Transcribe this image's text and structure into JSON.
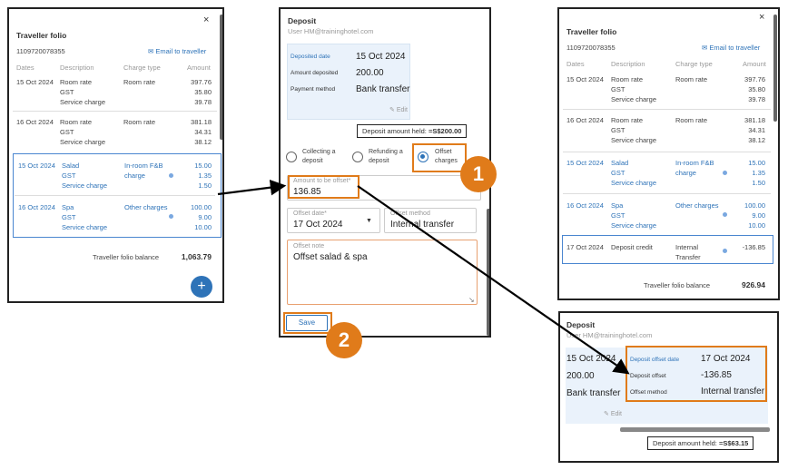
{
  "left_folio": {
    "title": "Traveller folio",
    "folio_number": "1109720078355",
    "email_label": "Email to traveller",
    "headers": [
      "Dates",
      "Description",
      "Charge type",
      "Amount"
    ],
    "rows": [
      {
        "date": "15 Oct 2024",
        "desc": [
          "Room rate",
          "GST",
          "Service charge"
        ],
        "type": "Room rate",
        "amounts": [
          "397.76",
          "35.80",
          "39.78"
        ]
      },
      {
        "date": "16 Oct 2024",
        "desc": [
          "Room rate",
          "GST",
          "Service charge"
        ],
        "type": "Room rate",
        "amounts": [
          "381.18",
          "34.31",
          "38.12"
        ]
      },
      {
        "date": "15 Oct 2024",
        "desc": [
          "Salad",
          "GST",
          "Service charge"
        ],
        "type": [
          "In-room F&B",
          "charge"
        ],
        "amounts": [
          "15.00",
          "1.35",
          "1.50"
        ]
      },
      {
        "date": "16 Oct 2024",
        "desc": [
          "Spa",
          "GST",
          "Service charge"
        ],
        "type": "Other charges",
        "amounts": [
          "100.00",
          "9.00",
          "10.00"
        ]
      }
    ],
    "balance_label": "Traveller folio balance",
    "balance_value": "1,063.79",
    "close": "×",
    "fab": "+"
  },
  "deposit_form": {
    "title": "Deposit",
    "user": "User HM@traininghotel.com",
    "deposited_date_label": "Deposited date",
    "deposited_date": "15 Oct 2024",
    "amount_deposited_label": "Amount deposited",
    "amount_deposited": "200.00",
    "payment_method_label": "Payment method",
    "payment_method": "Bank transfer",
    "edit_label": "Edit",
    "held_label": "Deposit amount held:",
    "held_value": "=S$200.00",
    "radio_collect": [
      "Collecting a",
      "deposit"
    ],
    "radio_refund": [
      "Refunding a",
      "deposit"
    ],
    "radio_offset": [
      "Offset",
      "charges"
    ],
    "amount_offset_label": "Amount to be offset*",
    "amount_offset_value": "136.85",
    "offset_date_label": "Offset date*",
    "offset_date_value": "17 Oct 2024",
    "offset_method_label": "Offset method",
    "offset_method_value": "Internal transfer",
    "offset_note_label": "Offset note",
    "offset_note_value": "Offset salad & spa",
    "save_label": "Save"
  },
  "right_folio": {
    "title": "Traveller folio",
    "folio_number": "1109720078355",
    "email_label": "Email to traveller",
    "headers": [
      "Dates",
      "Description",
      "Charge type",
      "Amount"
    ],
    "rows": [
      {
        "date": "15 Oct 2024",
        "desc": [
          "Room rate",
          "GST",
          "Service charge"
        ],
        "type": "Room rate",
        "amounts": [
          "397.76",
          "35.80",
          "39.78"
        ]
      },
      {
        "date": "16 Oct 2024",
        "desc": [
          "Room rate",
          "GST",
          "Service charge"
        ],
        "type": "Room rate",
        "amounts": [
          "381.18",
          "34.31",
          "38.12"
        ]
      },
      {
        "date": "15 Oct 2024",
        "desc": [
          "Salad",
          "GST",
          "Service charge"
        ],
        "type": [
          "In-room F&B",
          "charge"
        ],
        "amounts": [
          "15.00",
          "1.35",
          "1.50"
        ]
      },
      {
        "date": "16 Oct 2024",
        "desc": [
          "Spa",
          "GST",
          "Service charge"
        ],
        "type": "Other charges",
        "amounts": [
          "100.00",
          "9.00",
          "10.00"
        ]
      },
      {
        "date": "17 Oct 2024",
        "desc": [
          "Deposit credit"
        ],
        "type": [
          "Internal",
          "Transfer"
        ],
        "amounts": [
          "-136.85"
        ]
      }
    ],
    "balance_label": "Traveller folio balance",
    "balance_value": "926.94",
    "close": "×"
  },
  "deposit_result": {
    "title": "Deposit",
    "user": "User HM@traininghotel.com",
    "prev_date": "15 Oct 2024",
    "prev_amount": "200.00",
    "prev_method": "Bank transfer",
    "edit_label": "Edit",
    "offset_date_label": "Deposit offset date",
    "offset_date": "17 Oct 2024",
    "offset_label": "Deposit offset",
    "offset_value": "-136.85",
    "offset_method_label": "Offset method",
    "offset_method": "Internal transfer",
    "held_label": "Deposit amount held:",
    "held_value": "=S$63.15"
  },
  "badges": [
    "1",
    "2"
  ],
  "colors": {
    "accent_blue": "#2e73b8",
    "highlight_orange": "#e07b1a",
    "highlight_blue": "#4a86d0"
  }
}
